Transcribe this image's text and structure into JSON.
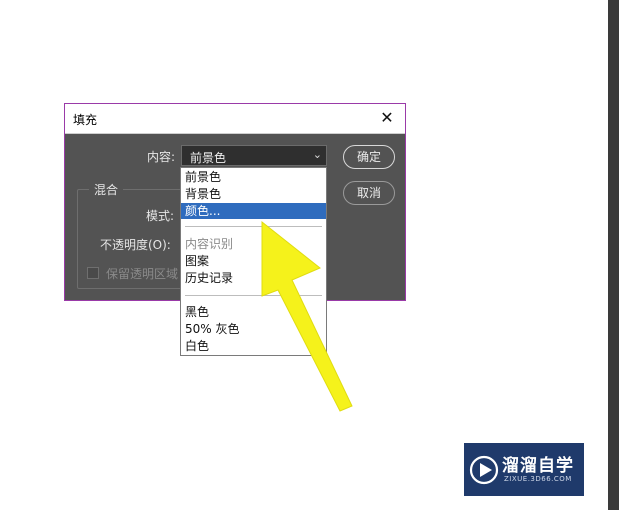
{
  "dialog": {
    "title": "填充",
    "close_glyph": "✕",
    "content_label": "内容:",
    "content_value": "前景色",
    "ok_label": "确定",
    "cancel_label": "取消",
    "blend_group_label": "混合",
    "mode_label": "模式:",
    "opacity_label": "不透明度(O):",
    "preserve_label": "保留透明区域"
  },
  "dropdown": {
    "options": [
      "前景色",
      "背景色",
      "颜色...",
      "内容识别",
      "图案",
      "历史记录",
      "黑色",
      "50% 灰色",
      "白色"
    ],
    "selected_index": 2,
    "disabled_index": 3
  },
  "watermark": {
    "name": "溜溜自学",
    "url": "ZIXUE.3D66.COM"
  },
  "colors": {
    "dialog_bg": "#535353",
    "highlight": "#2f6cbe",
    "arrow": "#f5f21b",
    "watermark_bg": "#1f3a6b"
  }
}
